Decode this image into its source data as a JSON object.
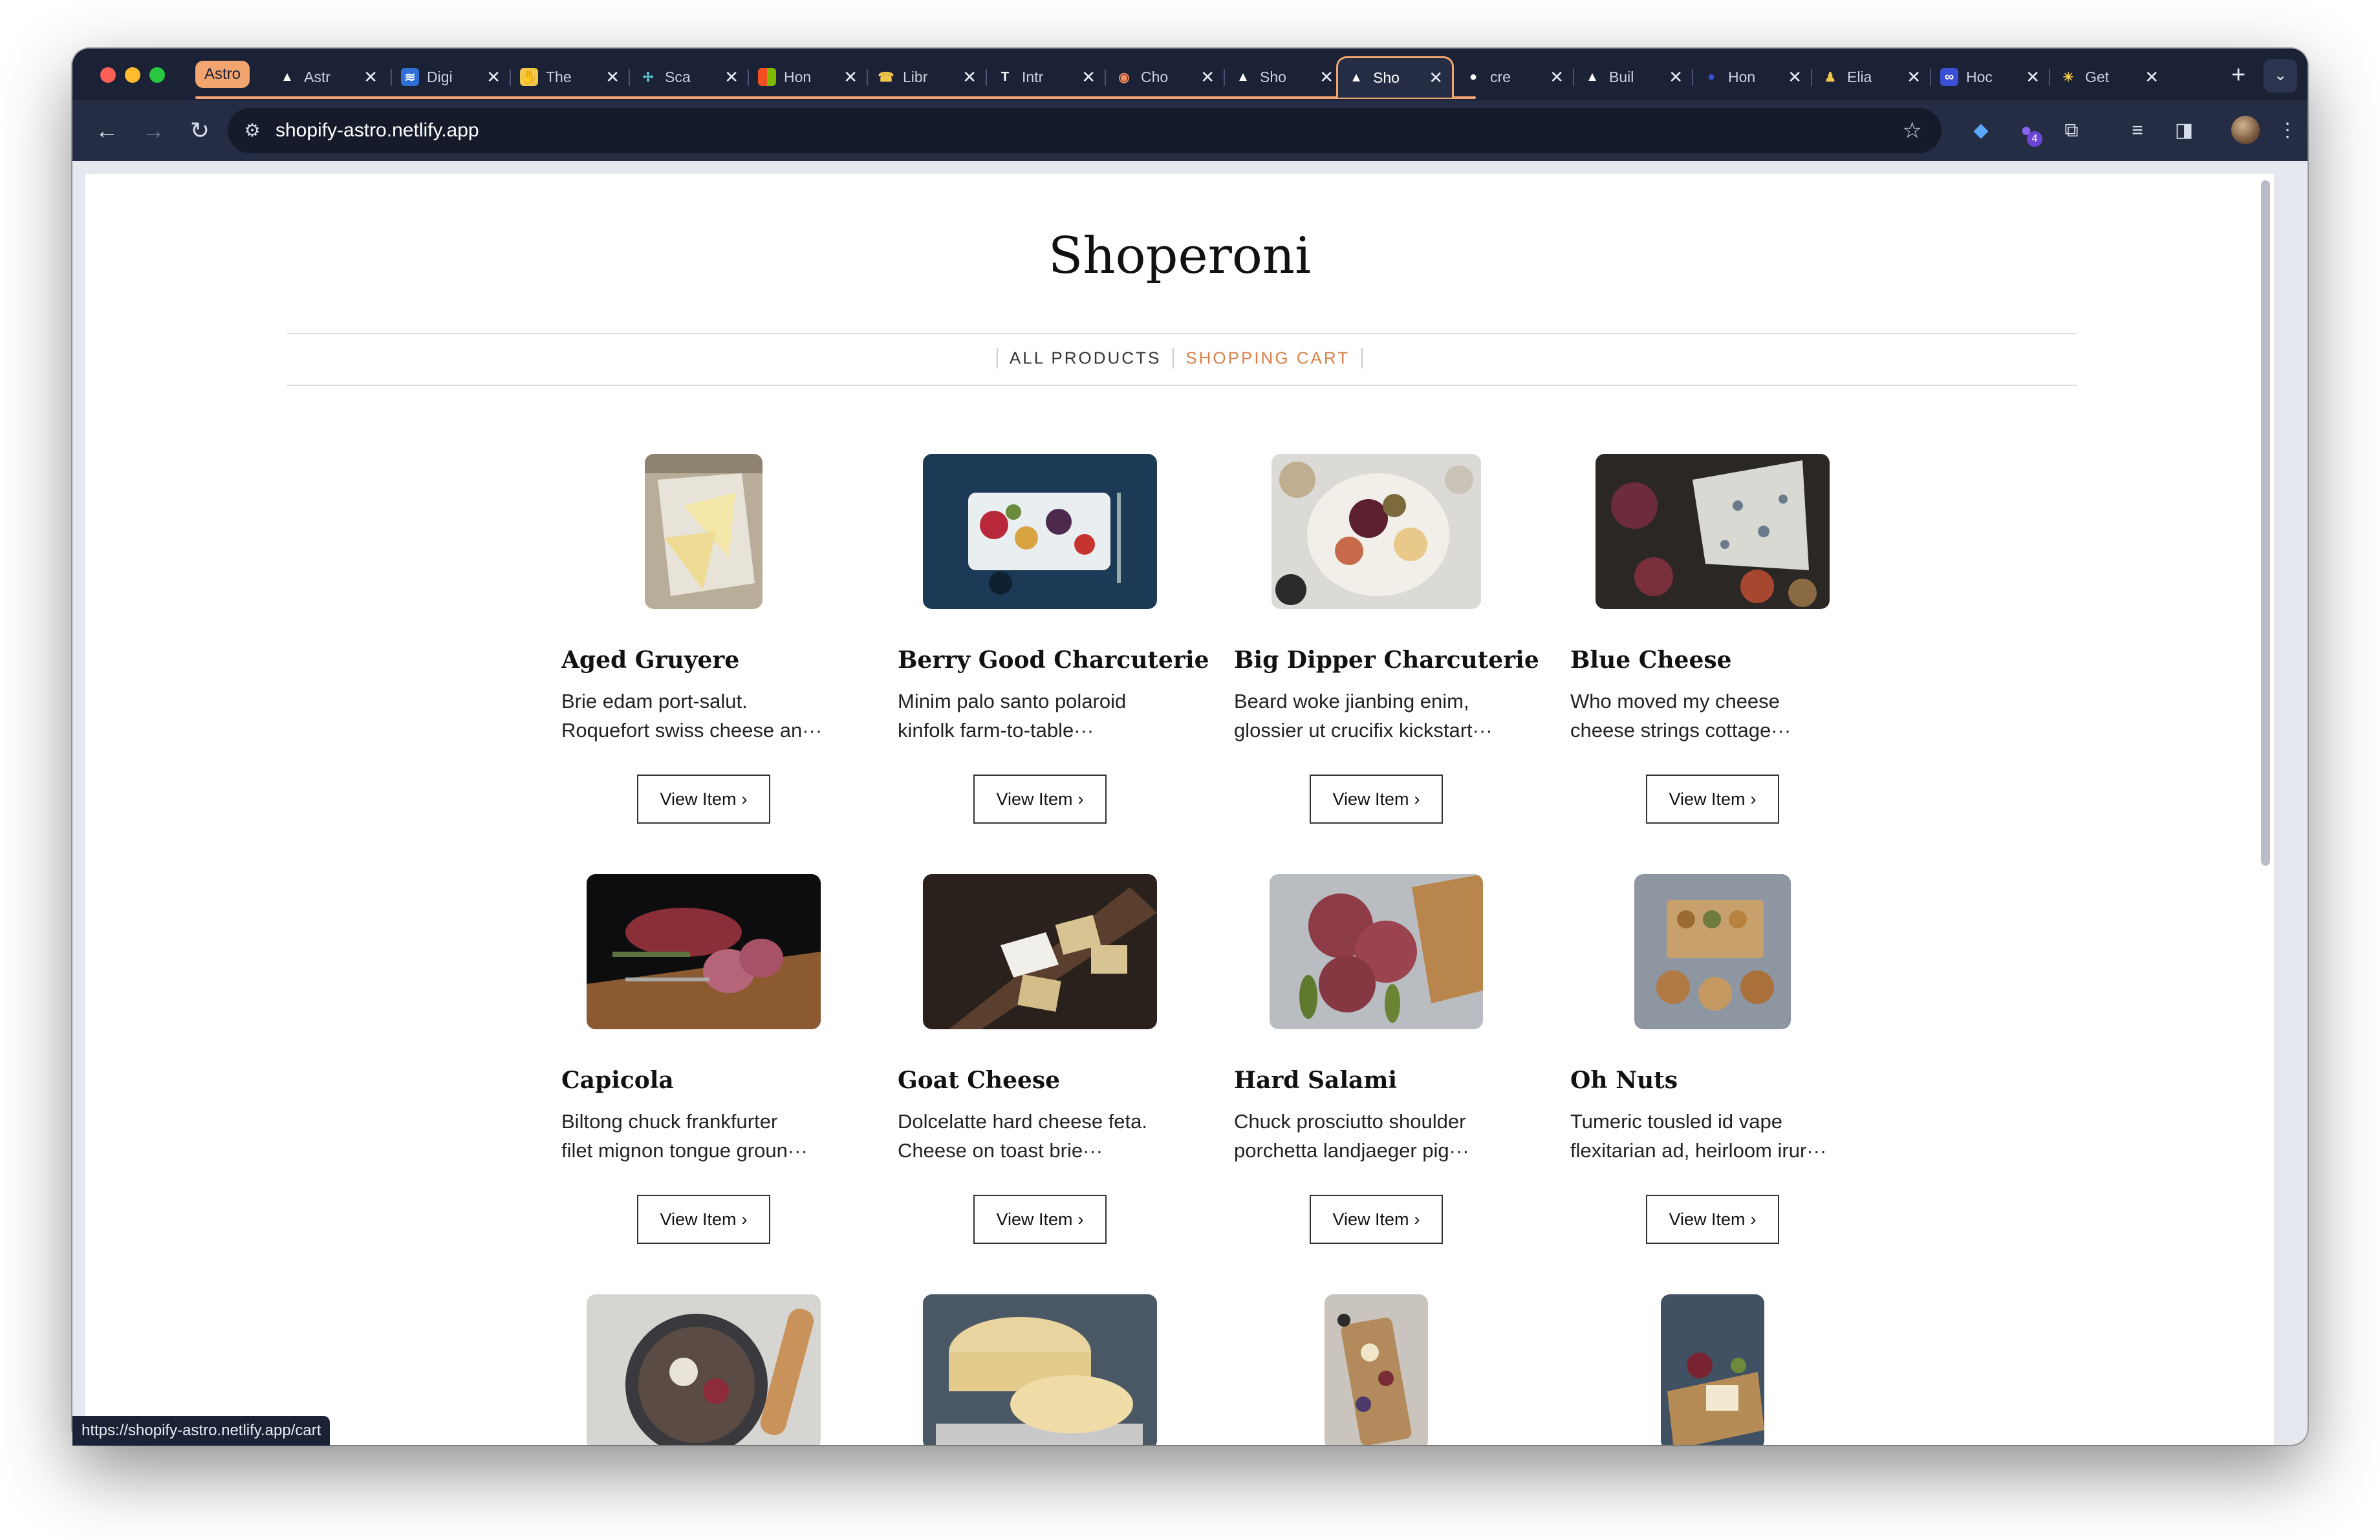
{
  "browser": {
    "tab_group": "Astro",
    "tabs": [
      {
        "title": "Astr",
        "icon": "astro-icon",
        "color": "#1b2235"
      },
      {
        "title": "Digi",
        "icon": "digital-icon",
        "color": "#2f6fd6"
      },
      {
        "title": "The",
        "icon": "hand-icon",
        "color": "#f2c94c"
      },
      {
        "title": "Sca",
        "icon": "sparkle-icon",
        "color": "#1b2235"
      },
      {
        "title": "Hon",
        "icon": "microsoft-icon",
        "color": "#1b2235"
      },
      {
        "title": "Libr",
        "icon": "library-icon",
        "color": "#1b2235"
      },
      {
        "title": "Intr",
        "icon": "ts-icon",
        "color": "#1b2235"
      },
      {
        "title": "Cho",
        "icon": "choose-icon",
        "color": "#1b2235"
      },
      {
        "title": "Sho",
        "icon": "astro-icon",
        "color": "#1b2235"
      },
      {
        "title": "Sho",
        "icon": "astro-icon",
        "color": "#1b2235",
        "active": true
      },
      {
        "title": "cre",
        "icon": "github-icon",
        "color": "#1b2235"
      },
      {
        "title": "Buil",
        "icon": "astro-icon",
        "color": "#1b2235"
      },
      {
        "title": "Hon",
        "icon": "circle-icon",
        "color": "#1b2235"
      },
      {
        "title": "Elia",
        "icon": "person-icon",
        "color": "#1b2235"
      },
      {
        "title": "Hoc",
        "icon": "link-icon",
        "color": "#1b2235"
      },
      {
        "title": "Get",
        "icon": "sun-icon",
        "color": "#1b2235"
      }
    ],
    "url": "shopify-astro.netlify.app",
    "extension_badge": "4",
    "status_url": "https://shopify-astro.netlify.app/cart"
  },
  "site": {
    "title": "Shoperoni",
    "nav": {
      "all_products": "ALL PRODUCTS",
      "cart": "SHOPPING CART"
    },
    "accent_color": "#d98149"
  },
  "products": [
    {
      "name": "Aged Gruyere",
      "desc1": "Brie edam port-salut.",
      "desc2": "Roquefort swiss cheese an···",
      "button": "View Item"
    },
    {
      "name": "Berry Good Charcuterie",
      "desc1": "Minim palo santo polaroid",
      "desc2": "kinfolk farm-to-table···",
      "button": "View Item"
    },
    {
      "name": "Big Dipper Charcuterie",
      "desc1": "Beard woke jianbing enim,",
      "desc2": "glossier ut crucifix kickstart···",
      "button": "View Item"
    },
    {
      "name": "Blue Cheese",
      "desc1": "Who moved my cheese",
      "desc2": "cheese strings cottage···",
      "button": "View Item"
    },
    {
      "name": "Capicola",
      "desc1": "Biltong chuck frankfurter",
      "desc2": "filet mignon tongue groun···",
      "button": "View Item"
    },
    {
      "name": "Goat Cheese",
      "desc1": "Dolcelatte hard cheese feta.",
      "desc2": "Cheese on toast brie···",
      "button": "View Item"
    },
    {
      "name": "Hard Salami",
      "desc1": "Chuck prosciutto shoulder",
      "desc2": "porchetta landjaeger pig···",
      "button": "View Item"
    },
    {
      "name": "Oh Nuts",
      "desc1": "Tumeric tousled id vape",
      "desc2": "flexitarian ad, heirloom irur···",
      "button": "View Item"
    }
  ]
}
